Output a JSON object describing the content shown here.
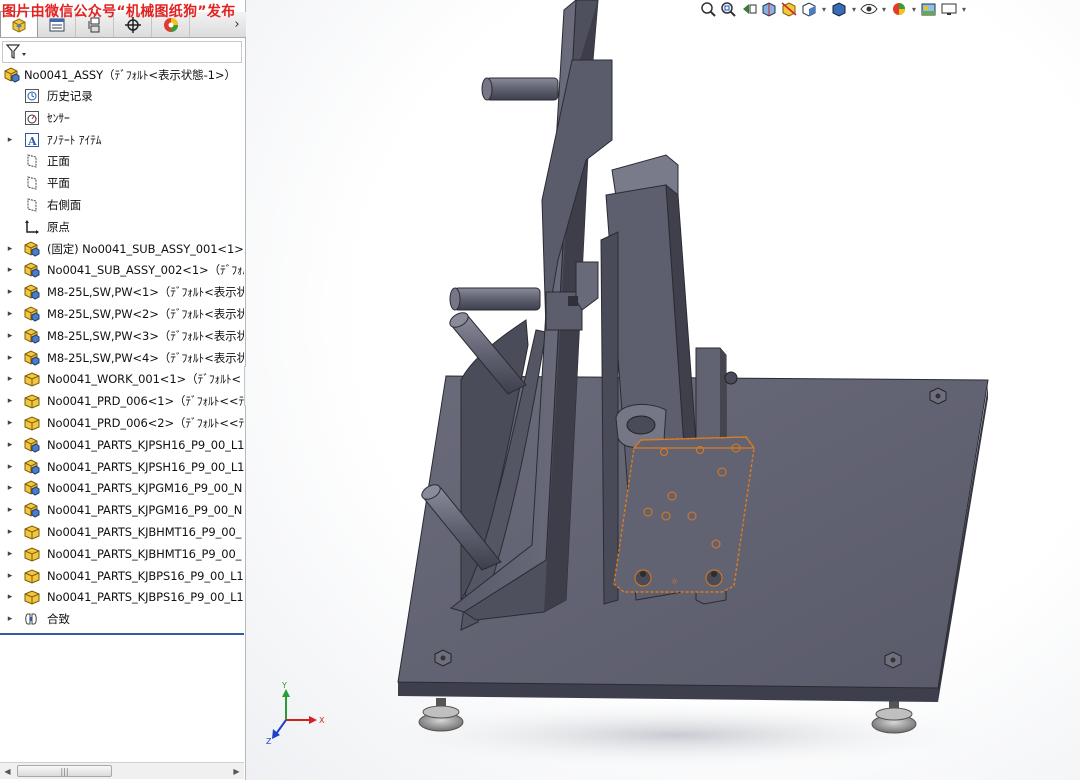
{
  "watermark": "图片由微信公众号“机械图纸狗”发布",
  "tabs": [
    {
      "name": "feature-manager",
      "active": true
    },
    {
      "name": "property-manager",
      "active": false
    },
    {
      "name": "configuration-manager",
      "active": false
    },
    {
      "name": "dimxpert-manager",
      "active": false
    },
    {
      "name": "display-manager",
      "active": false
    }
  ],
  "tabs_overflow": "›",
  "tree": {
    "root": {
      "label": "No0041_ASSY（ﾃﾞﾌｫﾙﾄ<表示状態-1>）",
      "icon": "assembly-icon"
    },
    "items": [
      {
        "label": "历史记录",
        "icon": "history-icon",
        "expand": false
      },
      {
        "label": "ｾﾝｻｰ",
        "icon": "sensor-icon",
        "expand": false
      },
      {
        "label": "ｱﾉﾃｰﾄ ｱｲﾃﾑ",
        "icon": "annotation-icon",
        "expand": true
      },
      {
        "label": "正面",
        "icon": "plane-icon",
        "expand": false
      },
      {
        "label": "平面",
        "icon": "plane-icon",
        "expand": false
      },
      {
        "label": "右側面",
        "icon": "plane-icon",
        "expand": false
      },
      {
        "label": "原点",
        "icon": "origin-icon",
        "expand": false
      },
      {
        "label": "(固定) No0041_SUB_ASSY_001<1>（",
        "icon": "subassembly-icon",
        "expand": true
      },
      {
        "label": "No0041_SUB_ASSY_002<1>（ﾃﾞﾌｫﾙ",
        "icon": "subassembly-icon",
        "expand": true
      },
      {
        "label": "M8-25L,SW,PW<1>（ﾃﾞﾌｫﾙﾄ<表示状",
        "icon": "subassembly-icon",
        "expand": true
      },
      {
        "label": "M8-25L,SW,PW<2>（ﾃﾞﾌｫﾙﾄ<表示状",
        "icon": "subassembly-icon",
        "expand": true
      },
      {
        "label": "M8-25L,SW,PW<3>（ﾃﾞﾌｫﾙﾄ<表示状",
        "icon": "subassembly-icon",
        "expand": true
      },
      {
        "label": "M8-25L,SW,PW<4>（ﾃﾞﾌｫﾙﾄ<表示状",
        "icon": "subassembly-icon",
        "expand": true
      },
      {
        "label": "No0041_WORK_001<1>（ﾃﾞﾌｫﾙﾄ<",
        "icon": "part-icon",
        "expand": true
      },
      {
        "label": "No0041_PRD_006<1>（ﾃﾞﾌｫﾙﾄ<<ﾃﾞ",
        "icon": "part-icon",
        "expand": true
      },
      {
        "label": "No0041_PRD_006<2>（ﾃﾞﾌｫﾙﾄ<<ﾃﾞ",
        "icon": "part-icon",
        "expand": true
      },
      {
        "label": "No0041_PARTS_KJPSH16_P9_00_L1",
        "icon": "subassembly-icon",
        "expand": true
      },
      {
        "label": "No0041_PARTS_KJPSH16_P9_00_L1",
        "icon": "subassembly-icon",
        "expand": true
      },
      {
        "label": "No0041_PARTS_KJPGM16_P9_00_N",
        "icon": "subassembly-icon",
        "expand": true
      },
      {
        "label": "No0041_PARTS_KJPGM16_P9_00_N",
        "icon": "subassembly-icon",
        "expand": true
      },
      {
        "label": "No0041_PARTS_KJBHMT16_P9_00_",
        "icon": "part-icon",
        "expand": true
      },
      {
        "label": "No0041_PARTS_KJBHMT16_P9_00_",
        "icon": "part-icon",
        "expand": true
      },
      {
        "label": "No0041_PARTS_KJBPS16_P9_00_L1",
        "icon": "part-icon",
        "expand": true
      },
      {
        "label": "No0041_PARTS_KJBPS16_P9_00_L1",
        "icon": "part-icon",
        "expand": true
      },
      {
        "label": "合致",
        "icon": "mates-icon",
        "expand": true
      }
    ]
  },
  "triad": {
    "y": "Y",
    "x": "X",
    "z": "Z"
  },
  "view_toolbar": [
    "zoom-to-fit-icon",
    "zoom-to-area-icon",
    "previous-view-icon",
    "section-view-icon",
    "dynamic-annotation-icon",
    "view-orientation-icon",
    "display-style-icon",
    "hide-show-icon",
    "edit-appearance-icon",
    "apply-scene-icon",
    "view-settings-icon"
  ],
  "colors": {
    "steel": "#5f6070",
    "steel_dark": "#3e3f4c",
    "steel_light": "#7f8090",
    "selection": "#e07a1c",
    "watermark": "#e32222",
    "tree_separator": "#2c5fa8"
  }
}
